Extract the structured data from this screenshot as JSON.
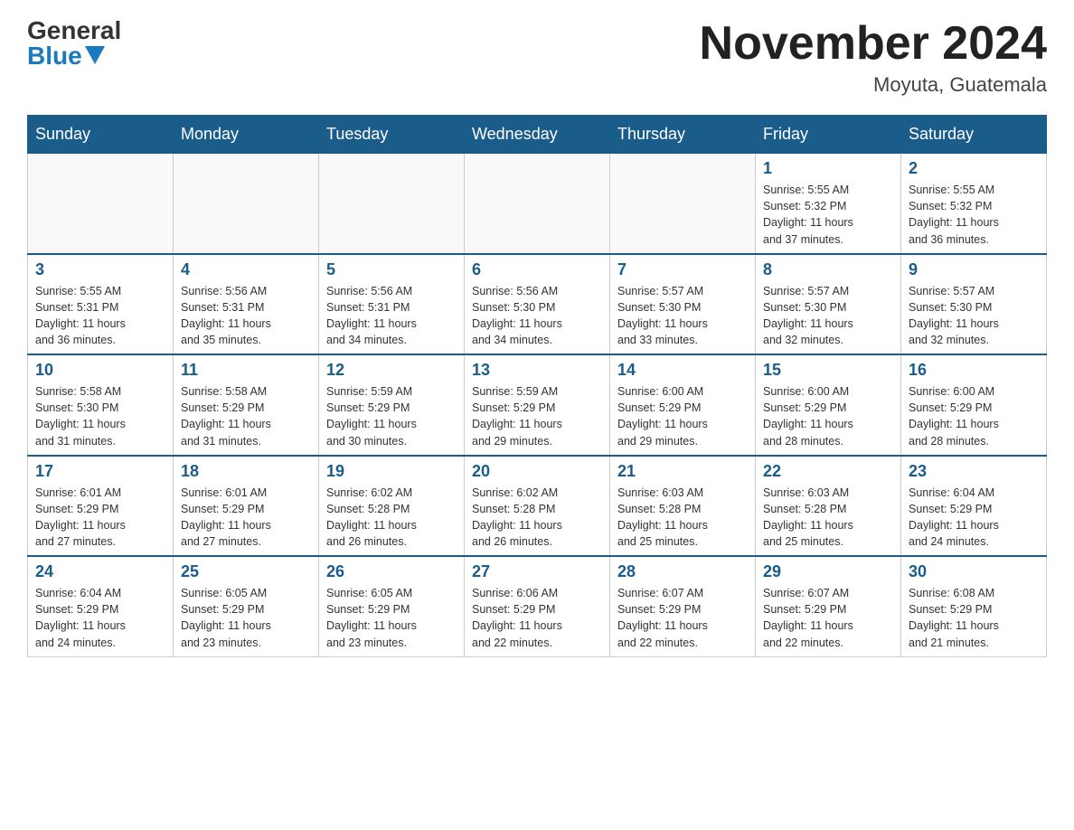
{
  "header": {
    "logo_general": "General",
    "logo_blue": "Blue",
    "month_title": "November 2024",
    "location": "Moyuta, Guatemala"
  },
  "days_of_week": [
    "Sunday",
    "Monday",
    "Tuesday",
    "Wednesday",
    "Thursday",
    "Friday",
    "Saturday"
  ],
  "weeks": [
    [
      {
        "day": "",
        "info": ""
      },
      {
        "day": "",
        "info": ""
      },
      {
        "day": "",
        "info": ""
      },
      {
        "day": "",
        "info": ""
      },
      {
        "day": "",
        "info": ""
      },
      {
        "day": "1",
        "info": "Sunrise: 5:55 AM\nSunset: 5:32 PM\nDaylight: 11 hours\nand 37 minutes."
      },
      {
        "day": "2",
        "info": "Sunrise: 5:55 AM\nSunset: 5:32 PM\nDaylight: 11 hours\nand 36 minutes."
      }
    ],
    [
      {
        "day": "3",
        "info": "Sunrise: 5:55 AM\nSunset: 5:31 PM\nDaylight: 11 hours\nand 36 minutes."
      },
      {
        "day": "4",
        "info": "Sunrise: 5:56 AM\nSunset: 5:31 PM\nDaylight: 11 hours\nand 35 minutes."
      },
      {
        "day": "5",
        "info": "Sunrise: 5:56 AM\nSunset: 5:31 PM\nDaylight: 11 hours\nand 34 minutes."
      },
      {
        "day": "6",
        "info": "Sunrise: 5:56 AM\nSunset: 5:30 PM\nDaylight: 11 hours\nand 34 minutes."
      },
      {
        "day": "7",
        "info": "Sunrise: 5:57 AM\nSunset: 5:30 PM\nDaylight: 11 hours\nand 33 minutes."
      },
      {
        "day": "8",
        "info": "Sunrise: 5:57 AM\nSunset: 5:30 PM\nDaylight: 11 hours\nand 32 minutes."
      },
      {
        "day": "9",
        "info": "Sunrise: 5:57 AM\nSunset: 5:30 PM\nDaylight: 11 hours\nand 32 minutes."
      }
    ],
    [
      {
        "day": "10",
        "info": "Sunrise: 5:58 AM\nSunset: 5:30 PM\nDaylight: 11 hours\nand 31 minutes."
      },
      {
        "day": "11",
        "info": "Sunrise: 5:58 AM\nSunset: 5:29 PM\nDaylight: 11 hours\nand 31 minutes."
      },
      {
        "day": "12",
        "info": "Sunrise: 5:59 AM\nSunset: 5:29 PM\nDaylight: 11 hours\nand 30 minutes."
      },
      {
        "day": "13",
        "info": "Sunrise: 5:59 AM\nSunset: 5:29 PM\nDaylight: 11 hours\nand 29 minutes."
      },
      {
        "day": "14",
        "info": "Sunrise: 6:00 AM\nSunset: 5:29 PM\nDaylight: 11 hours\nand 29 minutes."
      },
      {
        "day": "15",
        "info": "Sunrise: 6:00 AM\nSunset: 5:29 PM\nDaylight: 11 hours\nand 28 minutes."
      },
      {
        "day": "16",
        "info": "Sunrise: 6:00 AM\nSunset: 5:29 PM\nDaylight: 11 hours\nand 28 minutes."
      }
    ],
    [
      {
        "day": "17",
        "info": "Sunrise: 6:01 AM\nSunset: 5:29 PM\nDaylight: 11 hours\nand 27 minutes."
      },
      {
        "day": "18",
        "info": "Sunrise: 6:01 AM\nSunset: 5:29 PM\nDaylight: 11 hours\nand 27 minutes."
      },
      {
        "day": "19",
        "info": "Sunrise: 6:02 AM\nSunset: 5:28 PM\nDaylight: 11 hours\nand 26 minutes."
      },
      {
        "day": "20",
        "info": "Sunrise: 6:02 AM\nSunset: 5:28 PM\nDaylight: 11 hours\nand 26 minutes."
      },
      {
        "day": "21",
        "info": "Sunrise: 6:03 AM\nSunset: 5:28 PM\nDaylight: 11 hours\nand 25 minutes."
      },
      {
        "day": "22",
        "info": "Sunrise: 6:03 AM\nSunset: 5:28 PM\nDaylight: 11 hours\nand 25 minutes."
      },
      {
        "day": "23",
        "info": "Sunrise: 6:04 AM\nSunset: 5:29 PM\nDaylight: 11 hours\nand 24 minutes."
      }
    ],
    [
      {
        "day": "24",
        "info": "Sunrise: 6:04 AM\nSunset: 5:29 PM\nDaylight: 11 hours\nand 24 minutes."
      },
      {
        "day": "25",
        "info": "Sunrise: 6:05 AM\nSunset: 5:29 PM\nDaylight: 11 hours\nand 23 minutes."
      },
      {
        "day": "26",
        "info": "Sunrise: 6:05 AM\nSunset: 5:29 PM\nDaylight: 11 hours\nand 23 minutes."
      },
      {
        "day": "27",
        "info": "Sunrise: 6:06 AM\nSunset: 5:29 PM\nDaylight: 11 hours\nand 22 minutes."
      },
      {
        "day": "28",
        "info": "Sunrise: 6:07 AM\nSunset: 5:29 PM\nDaylight: 11 hours\nand 22 minutes."
      },
      {
        "day": "29",
        "info": "Sunrise: 6:07 AM\nSunset: 5:29 PM\nDaylight: 11 hours\nand 22 minutes."
      },
      {
        "day": "30",
        "info": "Sunrise: 6:08 AM\nSunset: 5:29 PM\nDaylight: 11 hours\nand 21 minutes."
      }
    ]
  ]
}
